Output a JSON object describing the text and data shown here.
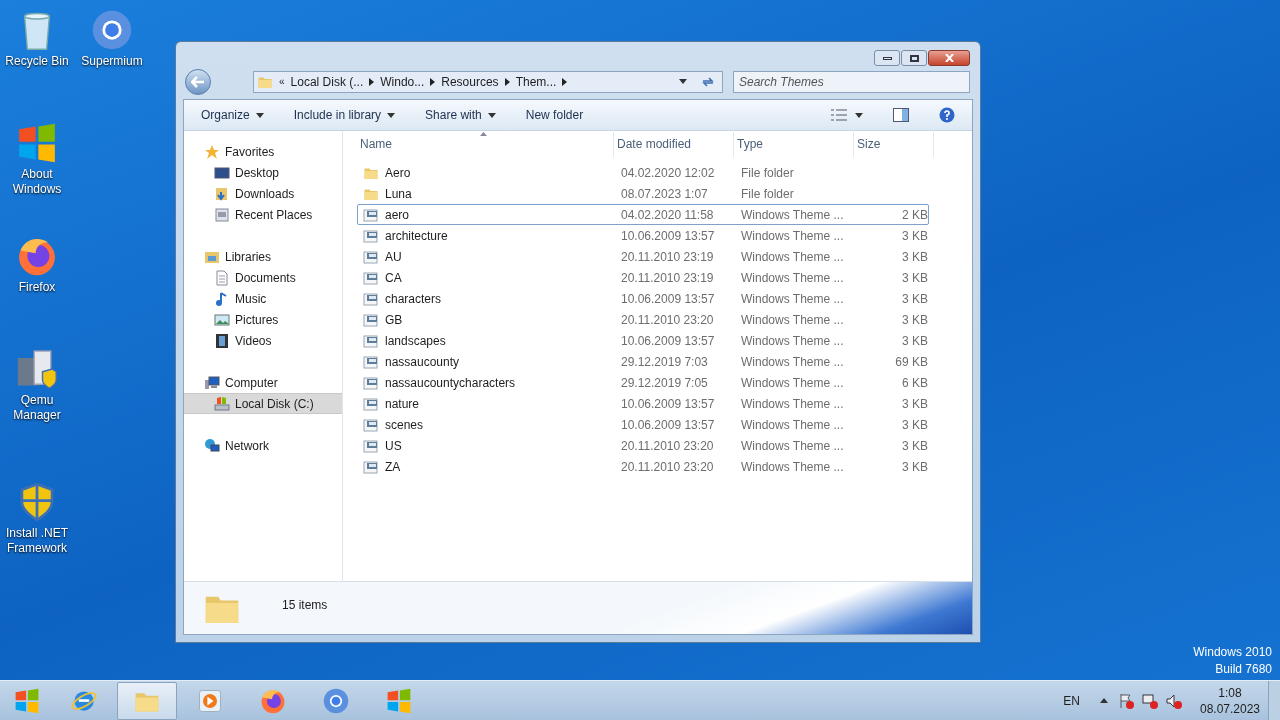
{
  "desktop_icons": [
    {
      "label": "Recycle Bin",
      "kind": "bin"
    },
    {
      "label": "Supermium",
      "kind": "ring"
    },
    {
      "label": "About Windows",
      "kind": "flag"
    },
    {
      "label": "Firefox",
      "kind": "fox"
    },
    {
      "label": "Qemu Manager",
      "kind": "server"
    },
    {
      "label": "Install .NET Framework",
      "kind": "shield"
    }
  ],
  "window": {
    "overflow_mark": "«",
    "breadcrumb": [
      "Local Disk (...",
      "Windo...",
      "Resources",
      "Them..."
    ],
    "search": {
      "placeholder": "Search Themes"
    },
    "toolbar": [
      {
        "label": "Organize",
        "dropdown": true
      },
      {
        "label": "Include in library",
        "dropdown": true
      },
      {
        "label": "Share with",
        "dropdown": true
      },
      {
        "label": "New folder",
        "dropdown": false
      }
    ],
    "nav": [
      {
        "label": "Favorites",
        "kind": "star",
        "selected": false,
        "children": [
          {
            "label": "Desktop",
            "kind": "desktop",
            "selected": false
          },
          {
            "label": "Downloads",
            "kind": "downloads",
            "selected": false
          },
          {
            "label": "Recent Places",
            "kind": "recent",
            "selected": false
          }
        ]
      },
      {
        "label": "Libraries",
        "kind": "library",
        "selected": false,
        "children": [
          {
            "label": "Documents",
            "kind": "doc",
            "selected": false
          },
          {
            "label": "Music",
            "kind": "music",
            "selected": false
          },
          {
            "label": "Pictures",
            "kind": "pictures",
            "selected": false
          },
          {
            "label": "Videos",
            "kind": "videos",
            "selected": false
          }
        ]
      },
      {
        "label": "Computer",
        "kind": "computer",
        "selected": false,
        "children": [
          {
            "label": "Local Disk (C:)",
            "kind": "disk",
            "selected": true
          }
        ]
      },
      {
        "label": "Network",
        "kind": "network",
        "selected": false
      }
    ],
    "columns": [
      "Name",
      "Date modified",
      "Type",
      "Size"
    ],
    "rows": [
      {
        "name": "Aero",
        "date": "04.02.2020 12:02",
        "type": "File folder",
        "size": "",
        "kind": "folder",
        "focused": false
      },
      {
        "name": "Luna",
        "date": "08.07.2023 1:07",
        "type": "File folder",
        "size": "",
        "kind": "folder",
        "focused": false
      },
      {
        "name": "aero",
        "date": "04.02.2020 11:58",
        "type": "Windows Theme ...",
        "size": "2 KB",
        "kind": "theme",
        "focused": true
      },
      {
        "name": "architecture",
        "date": "10.06.2009 13:57",
        "type": "Windows Theme ...",
        "size": "3 KB",
        "kind": "theme",
        "focused": false
      },
      {
        "name": "AU",
        "date": "20.11.2010 23:19",
        "type": "Windows Theme ...",
        "size": "3 KB",
        "kind": "theme",
        "focused": false
      },
      {
        "name": "CA",
        "date": "20.11.2010 23:19",
        "type": "Windows Theme ...",
        "size": "3 KB",
        "kind": "theme",
        "focused": false
      },
      {
        "name": "characters",
        "date": "10.06.2009 13:57",
        "type": "Windows Theme ...",
        "size": "3 KB",
        "kind": "theme",
        "focused": false
      },
      {
        "name": "GB",
        "date": "20.11.2010 23:20",
        "type": "Windows Theme ...",
        "size": "3 KB",
        "kind": "theme",
        "focused": false
      },
      {
        "name": "landscapes",
        "date": "10.06.2009 13:57",
        "type": "Windows Theme ...",
        "size": "3 KB",
        "kind": "theme",
        "focused": false
      },
      {
        "name": "nassaucounty",
        "date": "29.12.2019 7:03",
        "type": "Windows Theme ...",
        "size": "69 KB",
        "kind": "theme",
        "focused": false
      },
      {
        "name": "nassaucountycharacters",
        "date": "29.12.2019 7:05",
        "type": "Windows Theme ...",
        "size": "6 KB",
        "kind": "theme",
        "focused": false
      },
      {
        "name": "nature",
        "date": "10.06.2009 13:57",
        "type": "Windows Theme ...",
        "size": "3 KB",
        "kind": "theme",
        "focused": false
      },
      {
        "name": "scenes",
        "date": "10.06.2009 13:57",
        "type": "Windows Theme ...",
        "size": "3 KB",
        "kind": "theme",
        "focused": false
      },
      {
        "name": "US",
        "date": "20.11.2010 23:20",
        "type": "Windows Theme ...",
        "size": "3 KB",
        "kind": "theme",
        "focused": false
      },
      {
        "name": "ZA",
        "date": "20.11.2010 23:20",
        "type": "Windows Theme ...",
        "size": "3 KB",
        "kind": "theme",
        "focused": false
      }
    ],
    "status": "15 items"
  },
  "watermark": [
    "Windows 2010",
    "Build 7680"
  ],
  "taskbar": {
    "apps": [
      {
        "kind": "ie",
        "active": false
      },
      {
        "kind": "explorer",
        "active": true
      },
      {
        "kind": "media",
        "active": false
      },
      {
        "kind": "fox",
        "active": false
      },
      {
        "kind": "ring",
        "active": false
      },
      {
        "kind": "flag",
        "active": false
      }
    ],
    "language": "EN",
    "time": "1:08",
    "date": "08.07.2023"
  }
}
